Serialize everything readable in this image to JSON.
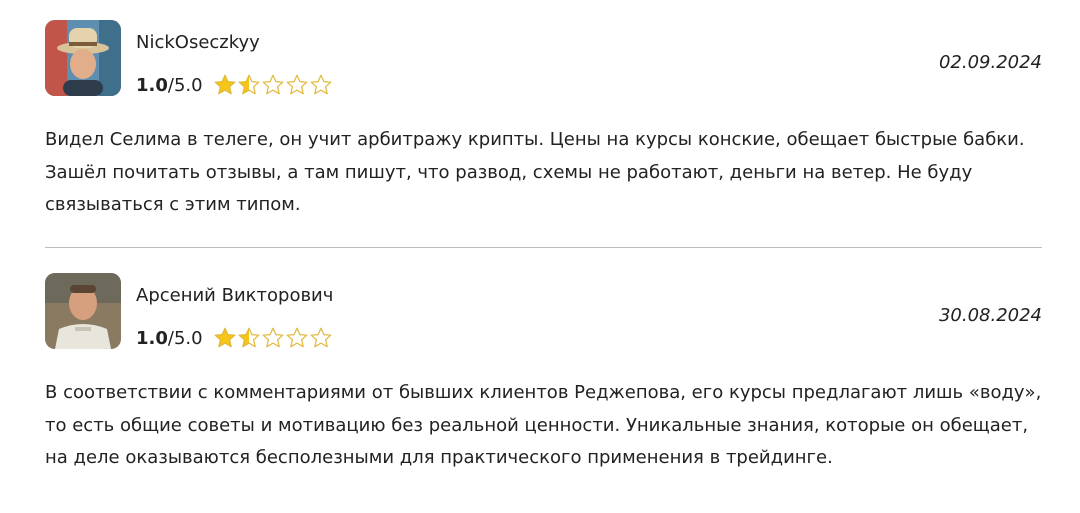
{
  "reviews": [
    {
      "author": "NickOseczkyy",
      "score": "1.0",
      "scale": "/5.0",
      "rating_value": 1.5,
      "date": "02.09.2024",
      "text": "Видел Селима в телеге, он учит арбитражу крипты. Цены на курсы конские, обещает быстрые бабки. Зашёл почитать отзывы, а там пишут, что развод, схемы не работают, деньги на ветер. Не буду связываться с этим типом."
    },
    {
      "author": "Арсений Викторович",
      "score": "1.0",
      "scale": "/5.0",
      "rating_value": 1.5,
      "date": "30.08.2024",
      "text": "В соответствии с комментариями от бывших клиентов Реджепова, его курсы предлагают лишь «воду», то есть общие советы и мотивацию без реальной ценности. Уникальные знания, которые он обещает, на деле оказываются бесполезными для практического применения в трейдинге."
    }
  ],
  "colors": {
    "star_fill": "#f5c518",
    "star_outline": "#e0b83a",
    "divider": "#bdbdbd"
  }
}
